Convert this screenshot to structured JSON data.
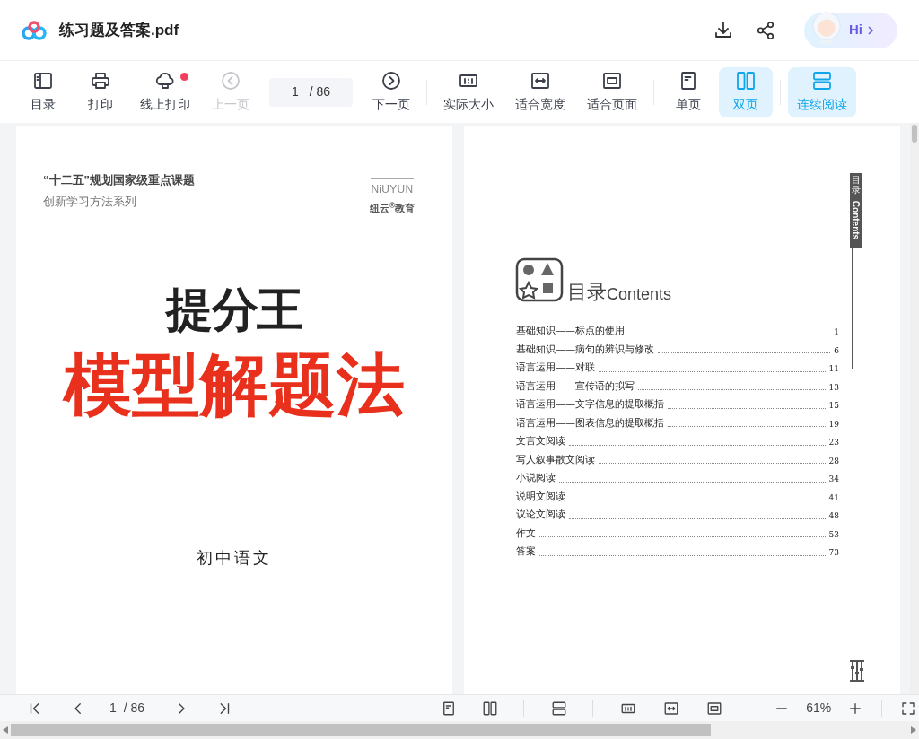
{
  "header": {
    "title": "练习题及答案.pdf",
    "assistant_label": "Hi"
  },
  "toolbar": [
    {
      "kind": "toc",
      "label": "目录",
      "selected": false,
      "disabled": false,
      "dot": false
    },
    {
      "kind": "print",
      "label": "打印",
      "selected": false,
      "disabled": false,
      "dot": false
    },
    {
      "kind": "cloud",
      "label": "线上打印",
      "selected": false,
      "disabled": false,
      "dot": true
    },
    {
      "kind": "prev",
      "label": "上一页",
      "selected": false,
      "disabled": true,
      "dot": false
    },
    {
      "kind": "page_field",
      "current": "1",
      "total": "/ 86"
    },
    {
      "kind": "next",
      "label": "下一页",
      "selected": false,
      "disabled": false,
      "dot": false
    },
    {
      "kind": "separator"
    },
    {
      "kind": "actual",
      "label": "实际大小",
      "selected": false,
      "disabled": false,
      "dot": false
    },
    {
      "kind": "fit_width",
      "label": "适合宽度",
      "selected": false,
      "disabled": false,
      "dot": false
    },
    {
      "kind": "fit_page",
      "label": "适合页面",
      "selected": false,
      "disabled": false,
      "dot": false
    },
    {
      "kind": "separator"
    },
    {
      "kind": "single",
      "label": "单页",
      "selected": false,
      "disabled": false,
      "dot": false
    },
    {
      "kind": "double",
      "label": "双页",
      "selected": true,
      "disabled": false,
      "dot": false
    },
    {
      "kind": "separator"
    },
    {
      "kind": "continuous",
      "label": "连续阅读",
      "selected": true,
      "disabled": false,
      "dot": false
    }
  ],
  "left_page": {
    "heading": "“十二五”规划国家级重点课题",
    "subheading": "创新学习方法系列",
    "logo_word": "NiUYUN",
    "logo_caption": "纽云$^{®}$教育",
    "brand": "提分王",
    "title": "模型解题法",
    "subject": "初中语文"
  },
  "right_page": {
    "tab_cn": "目录",
    "tab_en": "Contents",
    "heading_cn": "目录",
    "heading_en": "Contents",
    "entries": [
      {
        "title": "基础知识——标点的使用",
        "page": "1"
      },
      {
        "title": "基础知识——病句的辨识与修改",
        "page": "6"
      },
      {
        "title": "语言运用——对联",
        "page": "11"
      },
      {
        "title": "语言运用——宣传语的拟写",
        "page": "13"
      },
      {
        "title": "语言运用——文字信息的提取概括",
        "page": "15"
      },
      {
        "title": "语言运用——图表信息的提取概括",
        "page": "19"
      },
      {
        "title": "文言文阅读",
        "page": "23"
      },
      {
        "title": "写人叙事散文阅读",
        "page": "28"
      },
      {
        "title": "小说阅读",
        "page": "34"
      },
      {
        "title": "说明文阅读",
        "page": "41"
      },
      {
        "title": "议论文阅读",
        "page": "48"
      },
      {
        "title": "作文",
        "page": "53"
      },
      {
        "title": "答案",
        "page": "73"
      }
    ]
  },
  "bottom_bar": {
    "page": "1",
    "total": "/ 86",
    "zoom": "61%"
  }
}
